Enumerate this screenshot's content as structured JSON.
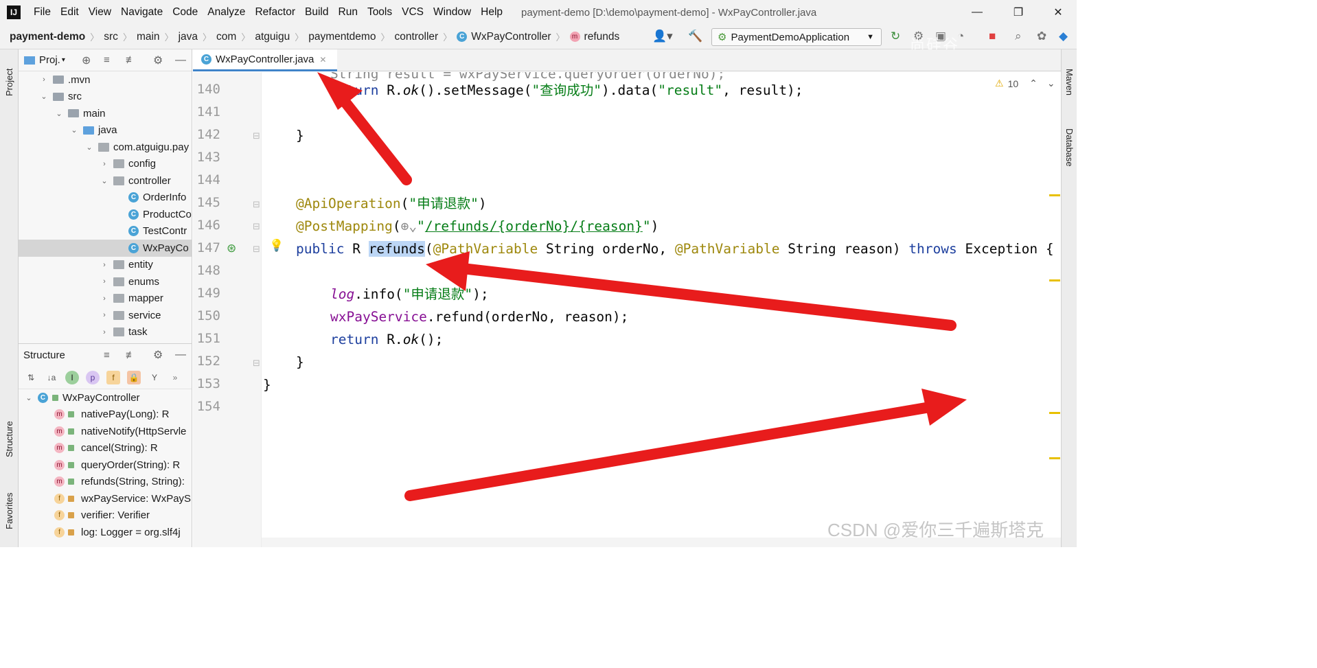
{
  "menubar": {
    "logo": "IJ",
    "items": [
      "File",
      "Edit",
      "View",
      "Navigate",
      "Code",
      "Analyze",
      "Refactor",
      "Build",
      "Run",
      "Tools",
      "VCS",
      "Window",
      "Help"
    ],
    "title": "payment-demo [D:\\demo\\payment-demo] - WxPayController.java"
  },
  "breadcrumb": {
    "project": "payment-demo",
    "parts": [
      "src",
      "main",
      "java",
      "com",
      "atguigu",
      "paymentdemo",
      "controller"
    ],
    "class": "WxPayController",
    "method": "refunds"
  },
  "run_config": "PaymentDemoApplication",
  "watermark_top": "尚硅谷",
  "project_panel": {
    "title": "Proj.",
    "items": [
      {
        "label": ".mvn",
        "indent": 1,
        "arrow": "›",
        "type": "folder"
      },
      {
        "label": "src",
        "indent": 1,
        "arrow": "⌄",
        "type": "folder"
      },
      {
        "label": "main",
        "indent": 2,
        "arrow": "⌄",
        "type": "folder"
      },
      {
        "label": "java",
        "indent": 3,
        "arrow": "⌄",
        "type": "folder-blue"
      },
      {
        "label": "com.atguigu.pay",
        "indent": 4,
        "arrow": "⌄",
        "type": "package"
      },
      {
        "label": "config",
        "indent": 5,
        "arrow": "›",
        "type": "package"
      },
      {
        "label": "controller",
        "indent": 5,
        "arrow": "⌄",
        "type": "package"
      },
      {
        "label": "OrderInfo",
        "indent": 6,
        "arrow": "",
        "type": "class"
      },
      {
        "label": "ProductCo",
        "indent": 6,
        "arrow": "",
        "type": "class"
      },
      {
        "label": "TestContr",
        "indent": 6,
        "arrow": "",
        "type": "class"
      },
      {
        "label": "WxPayCo",
        "indent": 6,
        "arrow": "",
        "type": "class",
        "selected": true
      },
      {
        "label": "entity",
        "indent": 5,
        "arrow": "›",
        "type": "package"
      },
      {
        "label": "enums",
        "indent": 5,
        "arrow": "›",
        "type": "package"
      },
      {
        "label": "mapper",
        "indent": 5,
        "arrow": "›",
        "type": "package"
      },
      {
        "label": "service",
        "indent": 5,
        "arrow": "›",
        "type": "package"
      },
      {
        "label": "task",
        "indent": 5,
        "arrow": "›",
        "type": "package"
      }
    ]
  },
  "structure_panel": {
    "title": "Structure",
    "root": "WxPayController",
    "members": [
      {
        "kind": "m",
        "label": "nativePay(Long): R",
        "vis": "pub"
      },
      {
        "kind": "m",
        "label": "nativeNotify(HttpServle",
        "vis": "pub"
      },
      {
        "kind": "m",
        "label": "cancel(String): R",
        "vis": "pub"
      },
      {
        "kind": "m",
        "label": "queryOrder(String): R",
        "vis": "pub"
      },
      {
        "kind": "m",
        "label": "refunds(String, String):",
        "vis": "pub"
      },
      {
        "kind": "f",
        "label": "wxPayService: WxPayS",
        "vis": "priv"
      },
      {
        "kind": "f",
        "label": "verifier: Verifier",
        "vis": "priv"
      },
      {
        "kind": "f",
        "label": "log: Logger = org.slf4j",
        "vis": "priv"
      }
    ]
  },
  "editor": {
    "tab": "WxPayController.java",
    "warnings": "10",
    "line_numbers": [
      "140",
      "141",
      "142",
      "143",
      "144",
      "145",
      "146",
      "147",
      "148",
      "149",
      "150",
      "151",
      "152",
      "153",
      "154"
    ]
  },
  "side_tabs": {
    "left": [
      "Project",
      "Structure",
      "Favorites"
    ],
    "right": [
      "Maven",
      "Database"
    ]
  },
  "watermark": "CSDN @爱你三千遍斯塔克"
}
